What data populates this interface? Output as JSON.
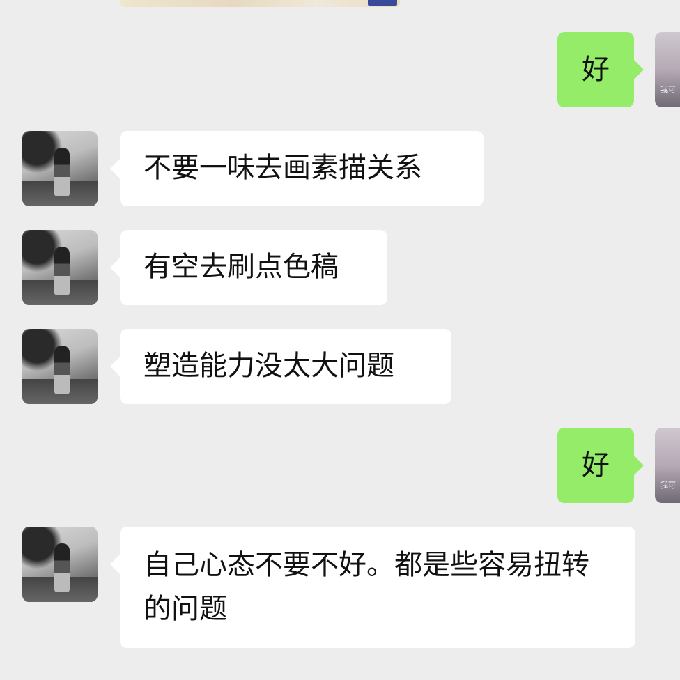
{
  "conversation": {
    "messages": [
      {
        "sender": "self",
        "text": "好"
      },
      {
        "sender": "other",
        "text": "不要一味去画素描关系"
      },
      {
        "sender": "other",
        "text": "有空去刷点色稿"
      },
      {
        "sender": "other",
        "text": "塑造能力没太大问题"
      },
      {
        "sender": "self",
        "text": "好"
      },
      {
        "sender": "other",
        "text": "自己心态不要不好。都是些容易扭转的问题"
      }
    ],
    "self_avatar_label": "我可"
  }
}
